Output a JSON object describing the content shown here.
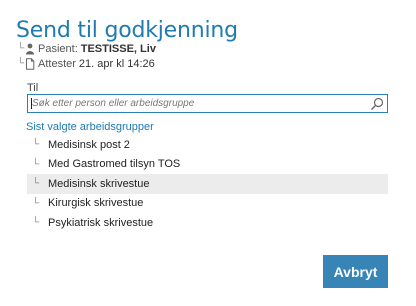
{
  "dialog": {
    "title": "Send til godkjenning"
  },
  "meta": {
    "tree_glyph": "└",
    "patient": {
      "icon": "person-icon",
      "label": "Pasient:",
      "value": "TESTISSE, Liv"
    },
    "attester": {
      "icon": "document-icon",
      "label": "Attester",
      "value": "21. apr kl 14:26"
    }
  },
  "recipient": {
    "label": "Til",
    "value": "",
    "placeholder": "Søk etter person eller arbeidsgruppe",
    "icon": "search-icon"
  },
  "recent_groups": {
    "label": "Sist valgte arbeidsgrupper",
    "items": [
      {
        "label": "Medisinsk post 2",
        "highlighted": false
      },
      {
        "label": "Med Gastromed tilsyn TOS",
        "highlighted": false
      },
      {
        "label": "Medisinsk skrivestue",
        "highlighted": true
      },
      {
        "label": "Kirurgisk skrivestue",
        "highlighted": false
      },
      {
        "label": "Psykiatrisk skrivestue",
        "highlighted": false
      }
    ]
  },
  "actions": {
    "cancel_label": "Avbryt"
  },
  "colors": {
    "accent": "#1f7bb0",
    "button": "#3784b7",
    "highlight_row": "#ececec"
  }
}
